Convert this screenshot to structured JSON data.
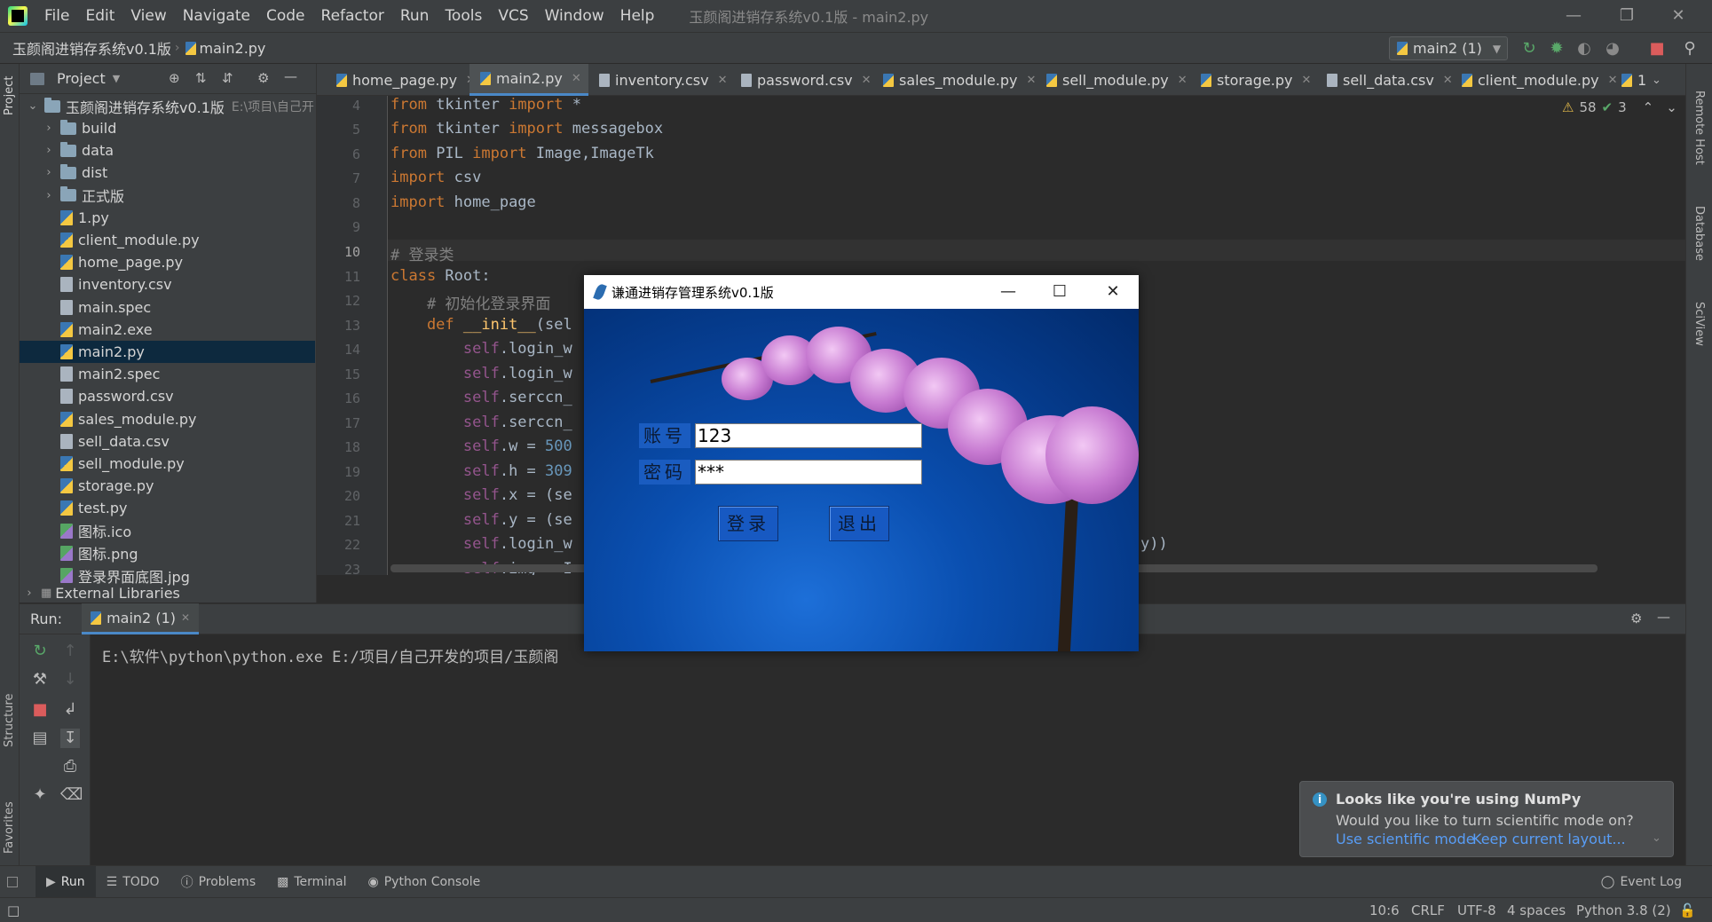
{
  "menubar": {
    "items": [
      "File",
      "Edit",
      "View",
      "Navigate",
      "Code",
      "Refactor",
      "Run",
      "Tools",
      "VCS",
      "Window",
      "Help"
    ],
    "window_title": "玉颜阁进销存系统v0.1版 - main2.py"
  },
  "navbar": {
    "project": "玉颜阁进销存系统v0.1版",
    "file": "main2.py",
    "run_config": "main2 (1)"
  },
  "project_panel": {
    "title": "Project",
    "root": "玉颜阁进销存系统v0.1版",
    "root_path": "E:\\项目\\自己开",
    "items": [
      {
        "label": "build",
        "type": "folder"
      },
      {
        "label": "data",
        "type": "folder"
      },
      {
        "label": "dist",
        "type": "folder"
      },
      {
        "label": "正式版",
        "type": "folder"
      },
      {
        "label": "1.py",
        "type": "py"
      },
      {
        "label": "client_module.py",
        "type": "py"
      },
      {
        "label": "home_page.py",
        "type": "py"
      },
      {
        "label": "inventory.csv",
        "type": "file"
      },
      {
        "label": "main.spec",
        "type": "file"
      },
      {
        "label": "main2.exe",
        "type": "py"
      },
      {
        "label": "main2.py",
        "type": "py"
      },
      {
        "label": "main2.spec",
        "type": "file"
      },
      {
        "label": "password.csv",
        "type": "file"
      },
      {
        "label": "sales_module.py",
        "type": "py"
      },
      {
        "label": "sell_data.csv",
        "type": "file"
      },
      {
        "label": "sell_module.py",
        "type": "py"
      },
      {
        "label": "storage.py",
        "type": "py"
      },
      {
        "label": "test.py",
        "type": "py"
      },
      {
        "label": "图标.ico",
        "type": "img"
      },
      {
        "label": "图标.png",
        "type": "img"
      },
      {
        "label": "登录界面底图.jpg",
        "type": "img"
      }
    ],
    "external_libraries": "External Libraries"
  },
  "editor_tabs": [
    "home_page.py",
    "main2.py",
    "inventory.csv",
    "password.csv",
    "sales_module.py",
    "sell_module.py",
    "storage.py",
    "sell_data.csv",
    "client_module.py",
    "1"
  ],
  "editor": {
    "line_numbers": [
      "4",
      "5",
      "6",
      "7",
      "8",
      "9",
      "10",
      "11",
      "12",
      "13",
      "14",
      "15",
      "16",
      "17",
      "18",
      "19",
      "20",
      "21",
      "22",
      "23"
    ],
    "lines": {
      "l4a": "from",
      "l4b": " tkinter ",
      "l4c": "import",
      "l4d": " *",
      "l5a": "from",
      "l5b": " tkinter ",
      "l5c": "import",
      "l5d": " messagebox",
      "l6a": "from",
      "l6b": " PIL ",
      "l6c": "import",
      "l6d": " Image,ImageTk",
      "l7a": "import",
      "l7b": " csv",
      "l8a": "import",
      "l8b": " home_page",
      "l10": "# 登录类",
      "l11a": "class",
      "l11b": " Root:",
      "l12": "    # 初始化登录界面",
      "l13a": "    def",
      "l13b": " __init__",
      "l13c": "(sel",
      "l14a": "        self",
      "l14b": ".login_w",
      "l15a": "        self",
      "l15b": ".login_w",
      "l16a": "        self",
      "l16b": ".serccn_",
      "l17a": "        self",
      "l17b": ".serccn_",
      "l18a": "        self",
      "l18b": ".w = ",
      "l18c": "500",
      "l19a": "        self",
      "l19b": ".h = ",
      "l19c": "309",
      "l20a": "        self",
      "l20b": ".x = (se",
      "l21a": "        self",
      "l21b": ".y = (se",
      "l22a": "        self",
      "l22b": ".login_w",
      "l22c": "y))",
      "l23a": "        self",
      "l23b": ".img = I"
    },
    "warnings": "58",
    "oks": "3"
  },
  "run_panel": {
    "label": "Run:",
    "tab": "main2 (1)",
    "console": "E:\\软件\\python\\python.exe E:/项目/自己开发的项目/玉颜阁"
  },
  "bottom_tabs": [
    "Run",
    "TODO",
    "Problems",
    "Terminal",
    "Python Console"
  ],
  "event_log": "Event Log",
  "statusbar": {
    "position": "10:6",
    "line_sep": "CRLF",
    "encoding": "UTF-8",
    "indent": "4 spaces",
    "interpreter": "Python 3.8 (2)"
  },
  "side_labels": {
    "project": "Project",
    "structure": "Structure",
    "favorites": "Favorites",
    "remote_host": "Remote Host",
    "database": "Database",
    "sciview": "SciView"
  },
  "notification": {
    "title": "Looks like you're using NumPy",
    "body": "Would you like to turn scientific mode on?",
    "link1": "Use scientific mode",
    "link2": "Keep current layout..."
  },
  "dialog": {
    "title": "谦通进销存管理系统v0.1版",
    "account_label": "账号",
    "password_label": "密码",
    "account_value": "123",
    "password_value": "***",
    "login_button": "登录",
    "exit_button": "退出"
  }
}
